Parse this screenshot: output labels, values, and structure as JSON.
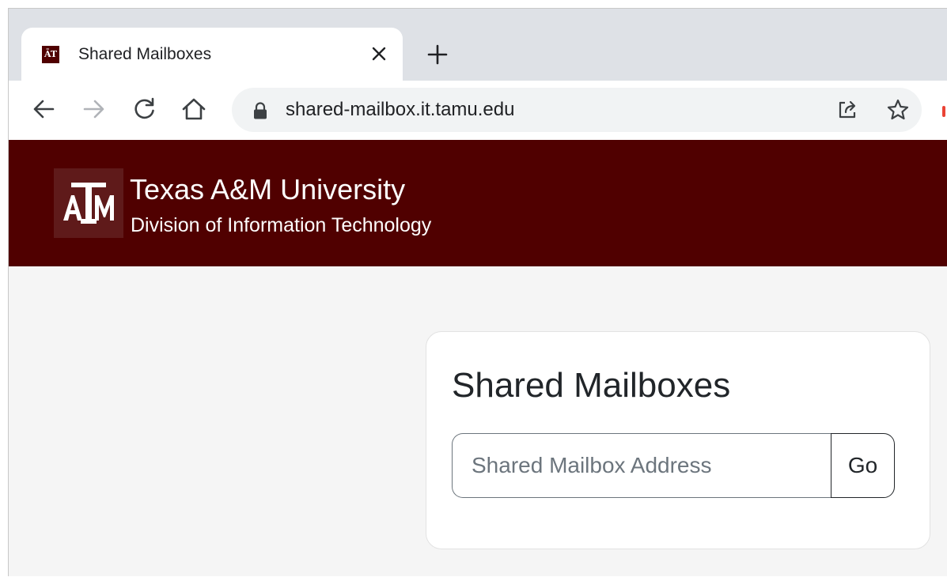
{
  "browser": {
    "tab": {
      "title": "Shared Mailboxes",
      "favicon_text": "ĀTM",
      "favicon_icon": "tamu-logo-icon",
      "close_icon": "close-icon"
    },
    "new_tab_icon": "plus-icon",
    "toolbar": {
      "back_icon": "arrow-left-icon",
      "forward_icon": "arrow-right-icon",
      "reload_icon": "reload-icon",
      "home_icon": "home-icon",
      "lock_icon": "lock-icon",
      "url": "shared-mailbox.it.tamu.edu",
      "share_icon": "share-icon",
      "bookmark_icon": "star-icon"
    }
  },
  "site_header": {
    "logo_icon": "tamu-logo-icon",
    "title": "Texas A&M University",
    "subtitle": "Division of Information Technology"
  },
  "card": {
    "title": "Shared Mailboxes",
    "input": {
      "placeholder": "Shared Mailbox Address",
      "value": ""
    },
    "go_label": "Go"
  },
  "colors": {
    "brand_maroon": "#500000",
    "page_background": "#f5f5f5",
    "tabstrip": "#dee1e6",
    "omnibox": "#f1f3f4"
  }
}
